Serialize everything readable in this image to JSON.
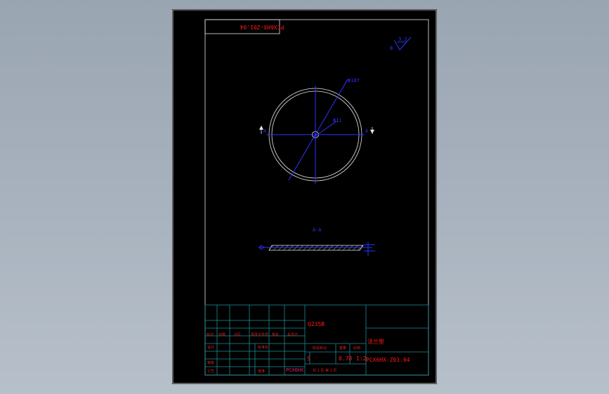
{
  "drawing": {
    "top_code": "PCX6HX-Z01.04",
    "roughness_symbol": "3.2",
    "roughness_mark": "B",
    "dia_outer": "Φ187",
    "dia_inner": "Φ11",
    "section_mark": "A",
    "section_label": "A-A"
  },
  "title_block": {
    "material": "Q235B",
    "part_name": "法兰垫",
    "drawing_no": "PCX6HX-Z01.04",
    "scale": "1:2",
    "weight": "0.78",
    "stage": "S",
    "sheet_text": "共 1 页 第 1 页",
    "rev_headers": [
      "标记",
      "处数",
      "分区",
      "更改文件号",
      "签名",
      "年月日"
    ],
    "people_rows": [
      [
        "设计",
        "",
        "标准化"
      ],
      [
        "审核",
        "",
        ""
      ],
      [
        "工艺",
        "",
        "批准"
      ]
    ],
    "stage_headers": [
      "阶段标记",
      "重量",
      "比例"
    ],
    "small_stamp": "PCX6HX"
  },
  "colors": {
    "sheet_bg": "#000000",
    "table_lines": "#1a8f99",
    "geometry": "#e6e6e6",
    "dimensions": "#2a33ff",
    "title_text": "#ff1a1a"
  }
}
